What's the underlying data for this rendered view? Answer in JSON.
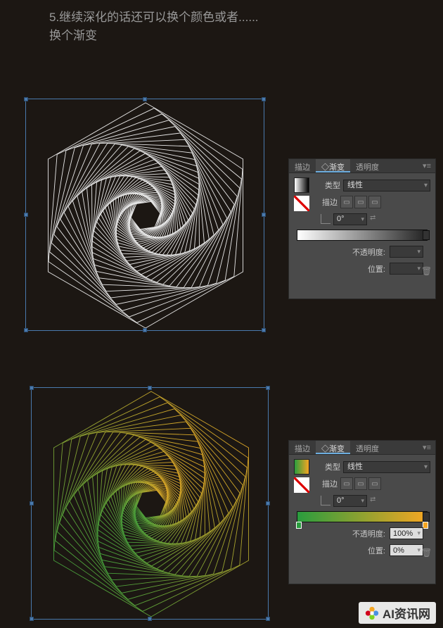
{
  "heading": {
    "line1": "5.继续深化的话还可以换个颜色或者......",
    "line2": "换个渐变"
  },
  "panel_tabs": {
    "stroke": "描边",
    "gradient": "◇渐变",
    "opacity": "透明度"
  },
  "panel1": {
    "type_label": "类型",
    "type_value": "线性",
    "stroke_label": "描边",
    "angle_value": "0°",
    "opacity_label": "不透明度:",
    "opacity_value": "",
    "position_label": "位置:",
    "position_value": ""
  },
  "panel2": {
    "type_label": "类型",
    "type_value": "线性",
    "stroke_label": "描边",
    "angle_value": "0°",
    "opacity_label": "不透明度:",
    "opacity_value": "100%",
    "position_label": "位置:",
    "position_value": "0%"
  },
  "watermark": "AI资讯网"
}
